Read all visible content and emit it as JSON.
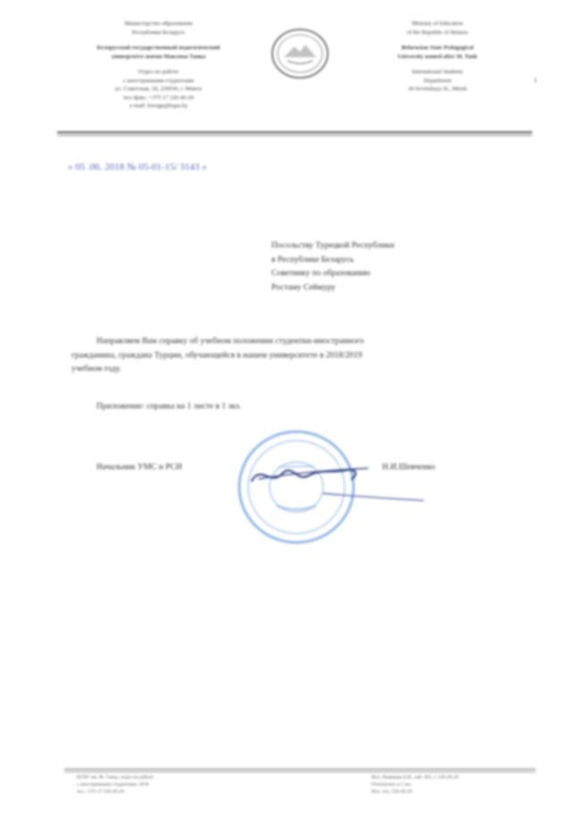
{
  "letterhead": {
    "left": {
      "lines_top": [
        "Министерство образования",
        "Республики Беларусь"
      ],
      "lines_bold": [
        "Белорусский государственный педагогический",
        "университет имени Максима Танка"
      ],
      "lines_bottom": [
        "Отдел по работе",
        "с иностранными студентами",
        "ул. Советская, 18, 220030, г. Минск",
        "тел./факс: +375 17 226-40-20",
        "e-mail: foreign@bspu.by"
      ]
    },
    "right": {
      "lines_top": [
        "Ministry of Education",
        "of the Republic of Belarus"
      ],
      "lines_bold": [
        "Belarusian State Pedagogical",
        "University named after M. Tank"
      ],
      "lines_bottom": [
        "International Students",
        "Department",
        "18 Sovetskaya St., Minsk"
      ]
    },
    "mark": "1"
  },
  "reference": "« 05 .06. 2018 № 05-01-15/ 3143 »",
  "addressee": [
    "Посольству Турецкой Республики",
    "в Республике Беларусь",
    "Советнику по образованию",
    "Ростаму Сеймуру"
  ],
  "body": [
    "Направляем Вам справку об учебном положении студентки-иностранного",
    "гражданина, граждана Турции, обучающейся в нашем университете в 2018/2019",
    "учебном году."
  ],
  "attachment": "Приложение: справка на 1 листе в 1 экз.",
  "signature": {
    "title": "Начальник УМС и РСИ",
    "name": "Н.И.Шевченко"
  },
  "footer": {
    "left": [
      "БГПУ им. М. Танка, отдел по работе",
      "с иностранными студентами, 2018",
      "тел. +375 17 226-40-20"
    ],
    "right": [
      "Исп. Новикова Е.В., каб. 405, т. 226-40-20",
      "Отпечатано в 2 экз.",
      "Исп. тел. 226-40-20"
    ]
  },
  "colors": {
    "ink": "#333333",
    "ref_ink": "#5b67b8",
    "stamp": "#6f9fdc",
    "signature": "#3a4a8a"
  }
}
